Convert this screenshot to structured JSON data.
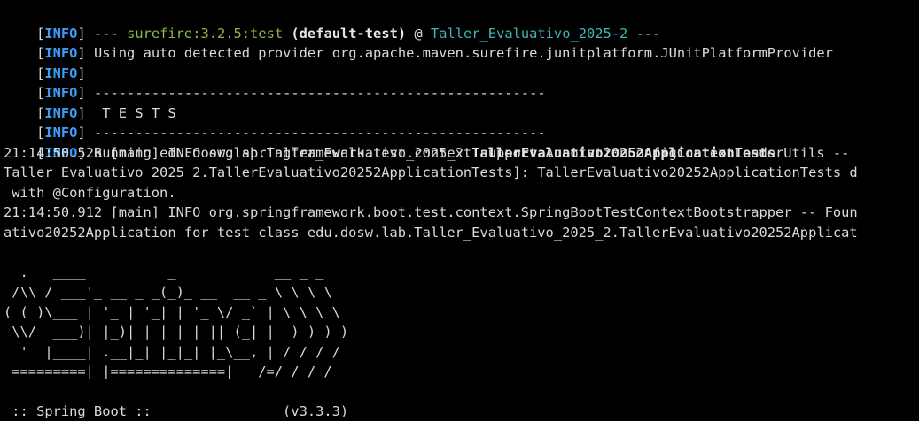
{
  "colors": {
    "background": "#000000",
    "text": "#d8dadc",
    "info_tag": "#3d9df3",
    "plugin": "#8db84b",
    "project": "#3fb6b3"
  },
  "log": {
    "info_word": "INFO",
    "line1": {
      "prefix": " --- ",
      "plugin": "surefire:3.2.5:test",
      "execution": " (default-test)",
      "at": " @ ",
      "project": "Taller_Evaluativo_2025-2",
      "suffix": " ---"
    },
    "line2": " Using auto detected provider org.apache.maven.surefire.junitplatform.JUnitPlatformProvider",
    "line3": "",
    "line4": " -------------------------------------------------------",
    "line5": "  T E S T S",
    "line6": " -------------------------------------------------------",
    "line7": {
      "prefix": " Running edu.dosw.lab.Taller_Evaluativo_2025_2.",
      "bold": "TallerEvaluativo20252ApplicationTests"
    },
    "line8": "21:14:50.526 [main] INFO org.springframework.test.context.support.AnnotationConfigContextLoaderUtils -- ",
    "line9": "Taller_Evaluativo_2025_2.TallerEvaluativo20252ApplicationTests]: TallerEvaluativo20252ApplicationTests d",
    "line10": " with @Configuration.",
    "line11": "21:14:50.912 [main] INFO org.springframework.boot.test.context.SpringBootTestContextBootstrapper -- Foun",
    "line12": "ativo20252Application for test class edu.dosw.lab.Taller_Evaluativo_2025_2.TallerEvaluativo20252Applicat"
  },
  "banner": {
    "lines": [
      "  .   ____          _            __ _ _",
      " /\\\\ / ___'_ __ _ _(_)_ __  __ _ \\ \\ \\ \\",
      "( ( )\\___ | '_ | '_| | '_ \\/ _` | \\ \\ \\ \\",
      " \\\\/  ___)| |_)| | | | | || (_| |  ) ) ) )",
      "  '  |____| .__|_| |_|_| |_\\__, | / / / /",
      " =========|_|==============|___/=/_/_/_/"
    ],
    "spring_boot_line": " :: Spring Boot ::                (v3.3.3)"
  }
}
